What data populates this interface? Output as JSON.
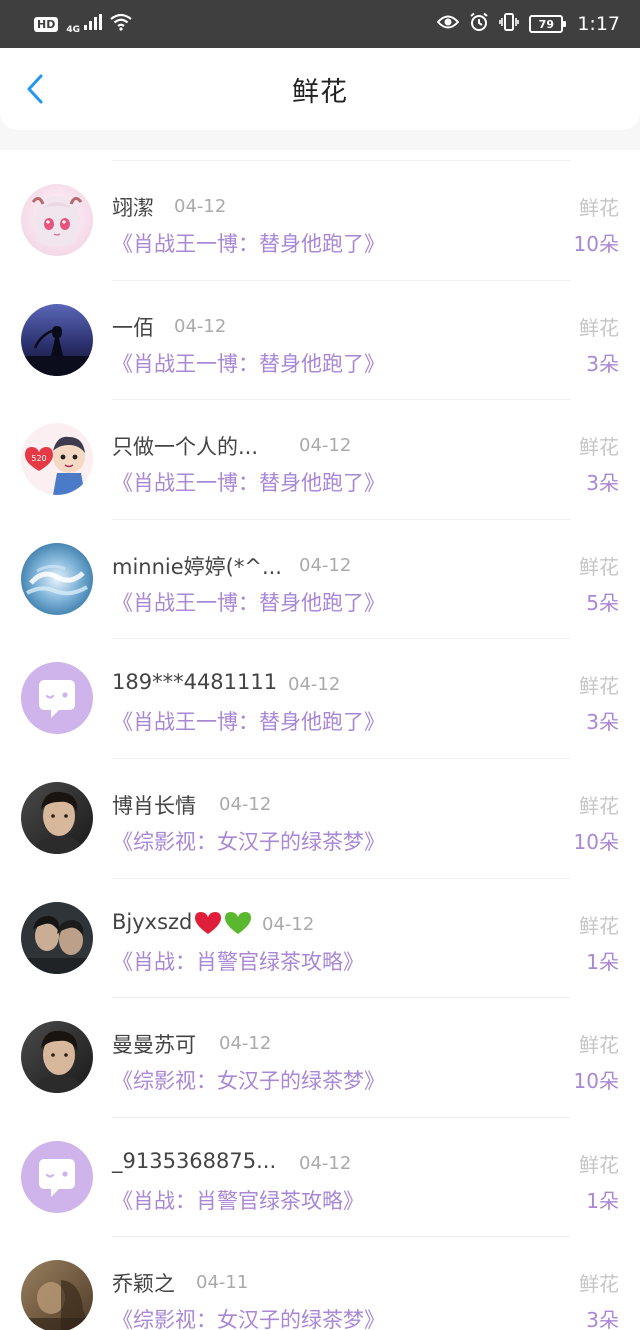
{
  "status_bar": {
    "hd": "HD",
    "network": "4G",
    "battery": "79",
    "time": "1:17"
  },
  "header": {
    "title": "鲜花",
    "back_icon": "chevron-left-icon",
    "accent_color": "#2196F3"
  },
  "colors": {
    "book_link": "#a987d6",
    "date": "#aaaaaa",
    "gift_type": "#c6c6c6"
  },
  "gifts": [
    {
      "name": "翊潔",
      "date": "04-12",
      "book": "《肖战王一博：替身他跑了》",
      "type": "鲜花",
      "count": "10朵",
      "avatar": "anime-girl-avatar"
    },
    {
      "name": "一佰",
      "date": "04-12",
      "book": "《肖战王一博：替身他跑了》",
      "type": "鲜花",
      "count": "3朵",
      "avatar": "night-silhouette-avatar"
    },
    {
      "name": "只做一个人的...",
      "date": "04-12",
      "book": "《肖战王一博：替身他跑了》",
      "type": "鲜花",
      "count": "3朵",
      "avatar": "cartoon-520-avatar"
    },
    {
      "name": "minnie婷婷(*^...",
      "date": "04-12",
      "book": "《肖战王一博：替身他跑了》",
      "type": "鲜花",
      "count": "5朵",
      "avatar": "ocean-avatar"
    },
    {
      "name": "189***4481111",
      "date": "04-12",
      "book": "《肖战王一博：替身他跑了》",
      "type": "鲜花",
      "count": "3朵",
      "avatar": "default-chat-avatar"
    },
    {
      "name": "博肖长情",
      "date": "04-12",
      "book": "《综影视：女汉子的绿茶梦》",
      "type": "鲜花",
      "count": "10朵",
      "avatar": "portrait-avatar"
    },
    {
      "name": "Bjyxszd",
      "date": "04-12",
      "book": "《肖战：肖警官绿茶攻略》",
      "type": "鲜花",
      "count": "1朵",
      "avatar": "two-people-avatar"
    },
    {
      "name": "曼曼苏可",
      "date": "04-12",
      "book": "《综影视：女汉子的绿茶梦》",
      "type": "鲜花",
      "count": "10朵",
      "avatar": "portrait-avatar"
    },
    {
      "name": "_9135368875...",
      "date": "04-12",
      "book": "《肖战：肖警官绿茶攻略》",
      "type": "鲜花",
      "count": "1朵",
      "avatar": "default-chat-avatar"
    },
    {
      "name": "乔颖之",
      "date": "04-11",
      "book": "《综影视：女汉子的绿茶梦》",
      "type": "鲜花",
      "count": "3朵",
      "avatar": "sepia-photo-avatar"
    }
  ]
}
